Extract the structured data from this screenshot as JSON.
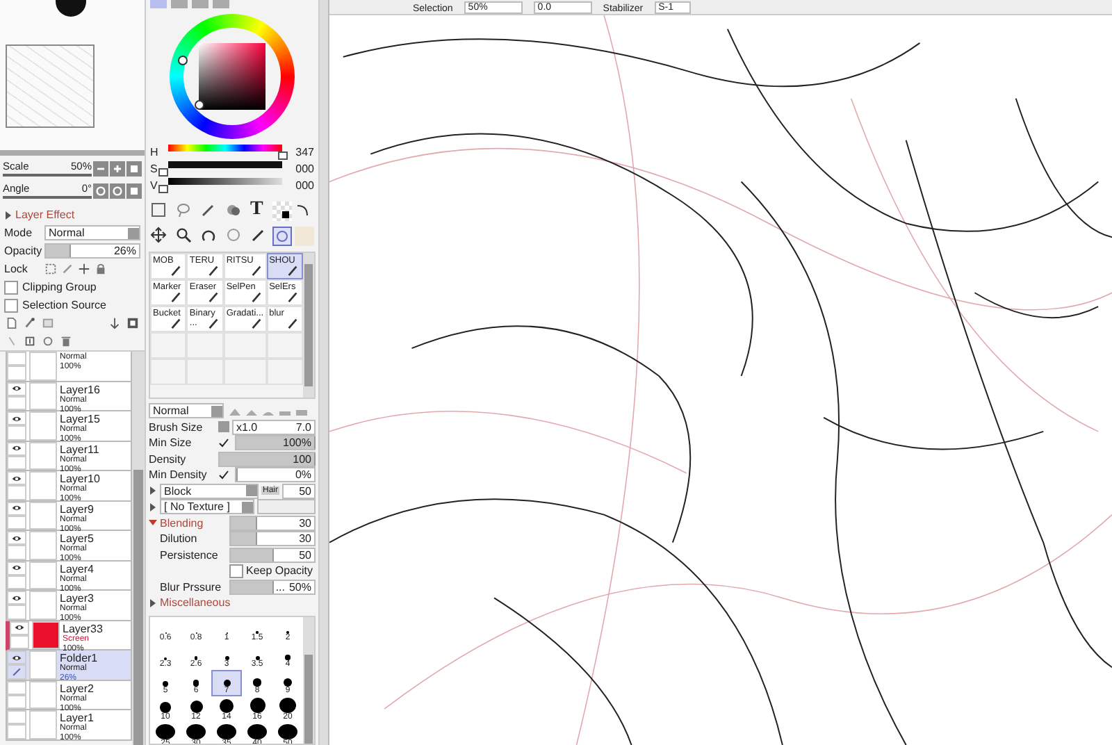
{
  "toolbar": {
    "selection_label": "Selection",
    "zoom": "50%",
    "angle": "0.0",
    "stabilizer_label": "Stabilizer",
    "stabilizer": "S-1"
  },
  "navigator": {
    "scale_label": "Scale",
    "scale": "50%",
    "angle_label": "Angle",
    "angle": "0°"
  },
  "layer_effect": {
    "title": "Layer Effect",
    "expanded": false,
    "mode_label": "Mode",
    "mode": "Normal",
    "opacity_label": "Opacity",
    "opacity": "26%",
    "level": 0.26,
    "lock_label": "Lock",
    "checkboxes": [
      {
        "label": "Clipping Group",
        "checked": false
      },
      {
        "label": "Selection Source",
        "checked": false
      }
    ]
  },
  "layers": [
    {
      "mode": "Normal",
      "opacity": "100%",
      "visible": false,
      "selected": false,
      "kind": "layer",
      "clipped": false
    },
    {
      "name": "Layer16",
      "mode": "Normal",
      "opacity": "100%",
      "visible": true,
      "selected": false,
      "kind": "layer",
      "clipped": false
    },
    {
      "name": "Layer15",
      "mode": "Normal",
      "opacity": "100%",
      "visible": true,
      "selected": false,
      "kind": "layer",
      "clipped": false
    },
    {
      "name": "Layer11",
      "mode": "Normal",
      "opacity": "100%",
      "visible": true,
      "selected": false,
      "kind": "layer",
      "clipped": false
    },
    {
      "name": "Layer10",
      "mode": "Normal",
      "opacity": "100%",
      "visible": true,
      "selected": false,
      "kind": "layer",
      "clipped": false
    },
    {
      "name": "Layer9",
      "mode": "Normal",
      "opacity": "100%",
      "visible": true,
      "selected": false,
      "kind": "layer",
      "clipped": false
    },
    {
      "name": "Layer5",
      "mode": "Normal",
      "opacity": "100%",
      "visible": true,
      "selected": false,
      "kind": "layer",
      "clipped": false
    },
    {
      "name": "Layer4",
      "mode": "Normal",
      "opacity": "100%",
      "visible": true,
      "selected": false,
      "kind": "layer",
      "clipped": false
    },
    {
      "name": "Layer3",
      "mode": "Normal",
      "opacity": "100%",
      "visible": true,
      "selected": false,
      "kind": "layer",
      "clipped": false
    },
    {
      "name": "Layer33",
      "mode": "Screen",
      "opacity": "100%",
      "visible": true,
      "selected": false,
      "kind": "layer",
      "clipped": true,
      "color": "#e8102a"
    },
    {
      "name": "Folder1",
      "mode": "Normal",
      "opacity": "26%",
      "visible": true,
      "selected": true,
      "kind": "folder",
      "clipped": false
    },
    {
      "name": "Layer2",
      "mode": "Normal",
      "opacity": "100%",
      "visible": false,
      "selected": false,
      "kind": "layer",
      "clipped": false
    },
    {
      "name": "Layer1",
      "mode": "Normal",
      "opacity": "100%",
      "visible": false,
      "selected": false,
      "kind": "layer",
      "clipped": false
    }
  ],
  "color": {
    "sliders": [
      {
        "label": "H",
        "value": "347",
        "level": 0.96
      },
      {
        "label": "S",
        "value": "000",
        "level": 0
      },
      {
        "label": "V",
        "value": "000",
        "level": 0
      }
    ]
  },
  "tools": {
    "text_tool": "T"
  },
  "brushes": [
    {
      "label": "MOB",
      "selected": false
    },
    {
      "label": "TERU",
      "selected": false
    },
    {
      "label": "RITSU",
      "selected": false
    },
    {
      "label": "SHOU",
      "selected": true
    },
    {
      "label": "Marker",
      "selected": false
    },
    {
      "label": "Eraser",
      "selected": false
    },
    {
      "label": "SelPen",
      "selected": false
    },
    {
      "label": "SelErs",
      "selected": false
    },
    {
      "label": "Bucket",
      "selected": false
    },
    {
      "label": "Binary ...",
      "selected": false
    },
    {
      "label": "Gradati...",
      "selected": false
    },
    {
      "label": "blur",
      "selected": false
    }
  ],
  "brush_settings": {
    "blend_mode": "Normal",
    "brush_size": {
      "label": "Brush Size",
      "multiplier": "x1.0",
      "value": "7.0"
    },
    "min_size": {
      "label": "Min Size",
      "checked": true,
      "value": "100%",
      "level": 1
    },
    "density": {
      "label": "Density",
      "value": "100",
      "level": 1
    },
    "min_density": {
      "label": "Min Density",
      "checked": true,
      "value": "0%",
      "level": 0
    },
    "shape": {
      "value": "Block",
      "hair_label": "Hair",
      "hair": "50"
    },
    "texture": {
      "value": "[ No Texture ]"
    },
    "blending": {
      "title": "Blending",
      "expanded": true,
      "value": "30",
      "level": 0.3
    },
    "dilution": {
      "label": "Dilution",
      "value": "30",
      "level": 0.3
    },
    "persistence": {
      "label": "Persistence",
      "value": "50",
      "level": 0.5
    },
    "keep_opacity": {
      "label": "Keep Opacity",
      "checked": false
    },
    "blur_pressure": {
      "label": "Blur Prssure",
      "prefix": "...",
      "value": "50%",
      "level": 0.5
    },
    "miscellaneous": {
      "title": "Miscellaneous",
      "expanded": false
    }
  },
  "brush_sizes": [
    {
      "label": "0.6",
      "selected": false
    },
    {
      "label": "0.8",
      "selected": false
    },
    {
      "label": "1",
      "selected": false
    },
    {
      "label": "1.5",
      "selected": false
    },
    {
      "label": "2",
      "selected": false
    },
    {
      "label": "2.3",
      "selected": false
    },
    {
      "label": "2.6",
      "selected": false
    },
    {
      "label": "3",
      "selected": false
    },
    {
      "label": "3.5",
      "selected": false
    },
    {
      "label": "4",
      "selected": false
    },
    {
      "label": "5",
      "selected": false
    },
    {
      "label": "6",
      "selected": false
    },
    {
      "label": "7",
      "selected": true
    },
    {
      "label": "8",
      "selected": false
    },
    {
      "label": "9",
      "selected": false
    },
    {
      "label": "10",
      "selected": false
    },
    {
      "label": "12",
      "selected": false
    },
    {
      "label": "14",
      "selected": false
    },
    {
      "label": "16",
      "selected": false
    },
    {
      "label": "20",
      "selected": false
    },
    {
      "label": "25",
      "selected": false
    },
    {
      "label": "30",
      "selected": false
    },
    {
      "label": "35",
      "selected": false
    },
    {
      "label": "40",
      "selected": false
    },
    {
      "label": "50",
      "selected": false
    }
  ]
}
